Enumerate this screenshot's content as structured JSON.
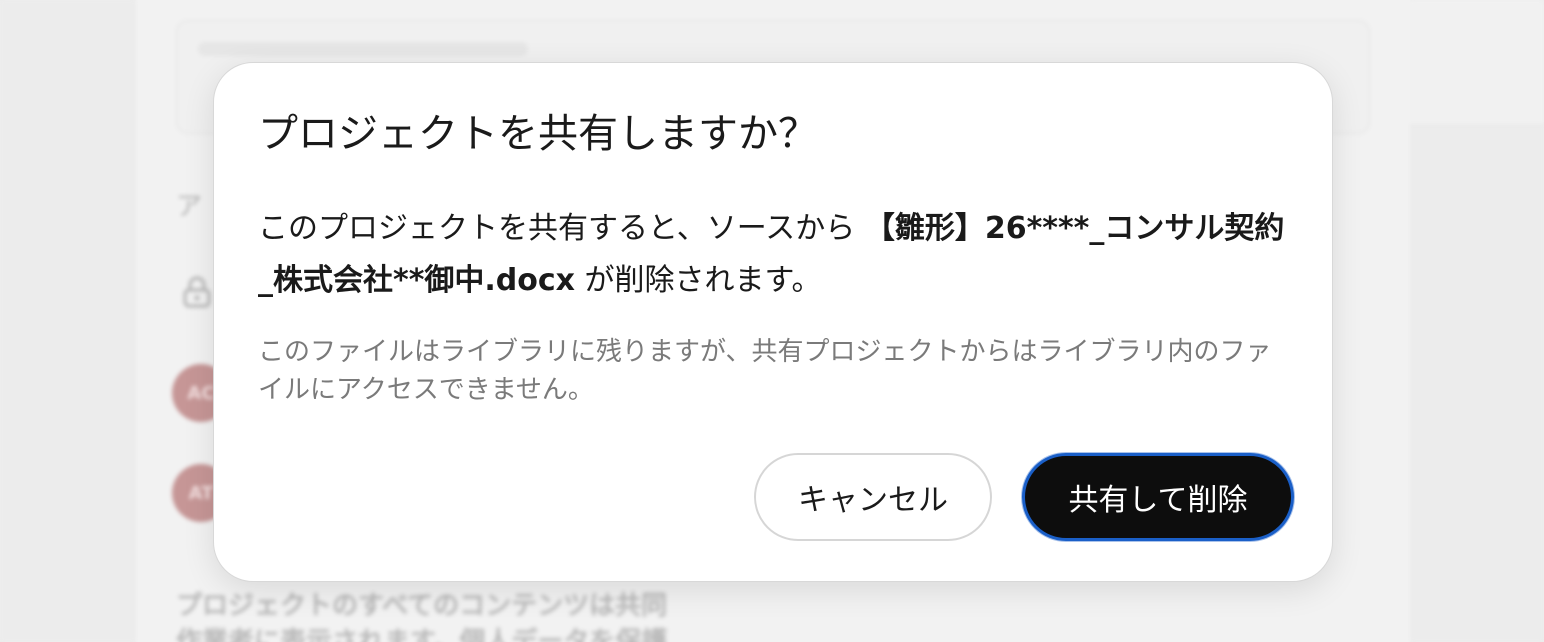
{
  "background": {
    "section_label": "ア",
    "avatars": [
      "AC",
      "AT"
    ],
    "footer_line1": "プロジェクトのすべてのコンテンツは共同",
    "footer_line2": "作業者に表示されます。個人データを保護"
  },
  "dialog": {
    "title": "プロジェクトを共有しますか？",
    "message_prefix": "このプロジェクトを共有すると、ソースから ",
    "file_name": "【雛形】26****_コンサル契約_株式会社**御中.docx",
    "message_suffix": " が削除されます。",
    "note": "このファイルはライブラリに残りますが、共有プロジェクトからはライブラリ内のファイルにアクセスできません。",
    "cancel_label": "キャンセル",
    "confirm_label": "共有して削除"
  },
  "colors": {
    "confirm_bg": "#0d0d0d",
    "confirm_focus_ring": "#1a5fc8",
    "avatar": "#c69696"
  }
}
